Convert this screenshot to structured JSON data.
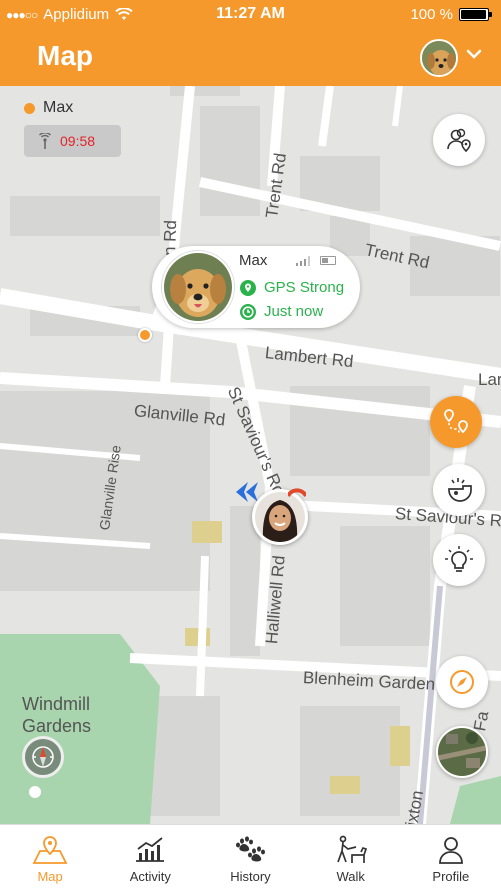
{
  "status_bar": {
    "carrier": "Applidium",
    "time": "11:27 AM",
    "battery": "100 %",
    "battery_level": 1.0
  },
  "header": {
    "title": "Map"
  },
  "pet_status": {
    "name": "Max",
    "timer": "09:58"
  },
  "pet_popup": {
    "name": "Max",
    "gps": "GPS Strong",
    "updated": "Just now"
  },
  "map": {
    "roads": {
      "trent_rd_vertical": "Trent Rd",
      "trent_rd": "Trent Rd",
      "lambert_rd": "Lambert Rd",
      "lambert_rd_cut": "Lar",
      "glanville_rd": "Glanville Rd",
      "glanville_rise": "Glanville Rise",
      "st_saviours_rd_diag": "St Saviour's Rd",
      "st_saviours_rd": "St Saviour's R",
      "halliwell_rd": "Halliwell Rd",
      "blenheim_gardens": "Blenheim Garden",
      "brixton": "ixton",
      "far": "Fa",
      "rd_fragment": "n Rd"
    },
    "park": "Windmill Gardens"
  },
  "tabs": [
    {
      "label": "Map",
      "icon": "map-icon",
      "active": true
    },
    {
      "label": "Activity",
      "icon": "activity-icon",
      "active": false
    },
    {
      "label": "History",
      "icon": "paw-icon",
      "active": false
    },
    {
      "label": "Walk",
      "icon": "walk-dog-icon",
      "active": false
    },
    {
      "label": "Profile",
      "icon": "profile-icon",
      "active": false
    }
  ],
  "colors": {
    "accent": "#f6992c",
    "gps_green": "#2bb24c",
    "timer_red": "#e0242a",
    "park": "#a8d5ad"
  }
}
